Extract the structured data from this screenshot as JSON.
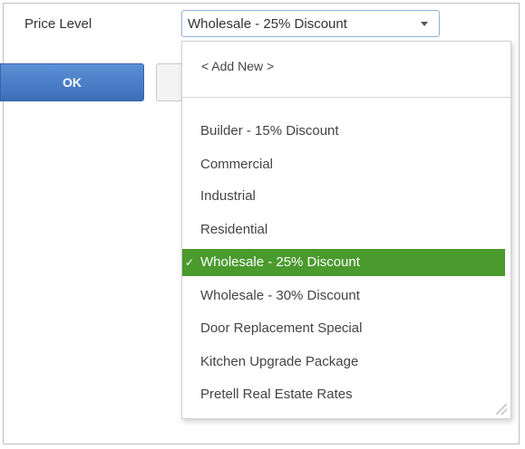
{
  "form": {
    "price_level_label": "Price Level",
    "price_level_value": "Wholesale - 25% Discount",
    "ok_label": "OK",
    "accent_color": "#4a90d9"
  },
  "dropdown": {
    "add_new_label": "< Add New >",
    "options": [
      "Builder - 15% Discount",
      "Commercial",
      "Industrial",
      "Residential",
      "Wholesale - 25% Discount",
      "Wholesale - 30% Discount",
      "Door Replacement Special",
      "Kitchen Upgrade Package",
      "Pretell Real Estate Rates"
    ],
    "selected_index": 4,
    "selected_color": "#4a9a2e",
    "check_icon": "checkmark-icon"
  }
}
